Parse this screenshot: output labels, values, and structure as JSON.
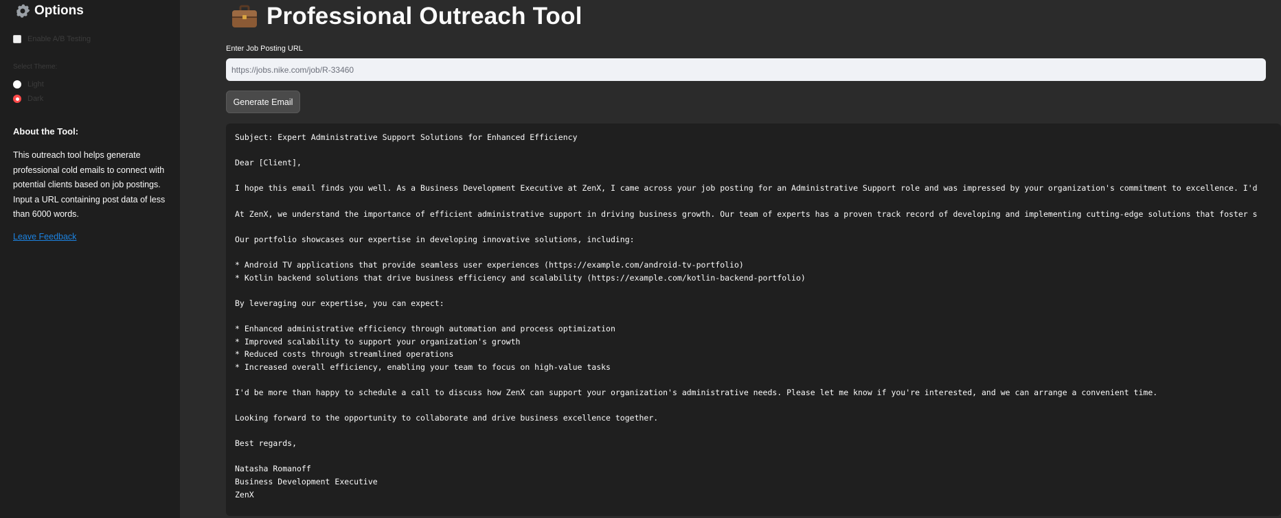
{
  "sidebar": {
    "title": "Options",
    "ab_testing_label": "Enable A/B Testing",
    "theme_label": "Select Theme:",
    "theme_options": [
      "Light",
      "Dark"
    ],
    "theme_selected": "Dark",
    "about_heading": "About the Tool:",
    "about_text": "This outreach tool helps generate professional cold emails to connect with potential clients based on job postings. Input a URL containing post data of less than 6000 words.",
    "feedback_link": "Leave Feedback"
  },
  "main": {
    "title": "Professional Outreach Tool",
    "url_label": "Enter Job Posting URL",
    "url_placeholder": "https://jobs.nike.com/job/R-33460",
    "generate_button": "Generate Email",
    "email_output": "Subject: Expert Administrative Support Solutions for Enhanced Efficiency\n\nDear [Client],\n\nI hope this email finds you well. As a Business Development Executive at ZenX, I came across your job posting for an Administrative Support role and was impressed by your organization's commitment to excellence. I'd\n\nAt ZenX, we understand the importance of efficient administrative support in driving business growth. Our team of experts has a proven track record of developing and implementing cutting-edge solutions that foster s\n\nOur portfolio showcases our expertise in developing innovative solutions, including:\n\n* Android TV applications that provide seamless user experiences (https://example.com/android-tv-portfolio)\n* Kotlin backend solutions that drive business efficiency and scalability (https://example.com/kotlin-backend-portfolio)\n\nBy leveraging our expertise, you can expect:\n\n* Enhanced administrative efficiency through automation and process optimization\n* Improved scalability to support your organization's growth\n* Reduced costs through streamlined operations\n* Increased overall efficiency, enabling your team to focus on high-value tasks\n\nI'd be more than happy to schedule a call to discuss how ZenX can support your organization's administrative needs. Please let me know if you're interested, and we can arrange a convenient time.\n\nLooking forward to the opportunity to collaborate and drive business excellence together.\n\nBest regards,\n\nNatasha Romanoff\nBusiness Development Executive\nZenX"
  },
  "icons": {
    "options": "gear-icon",
    "title": "briefcase-icon"
  },
  "colors": {
    "main_bg": "#2b2b2b",
    "sidebar_bg": "#1e1e1e",
    "code_bg": "#1f1f1f",
    "accent": "#ff4b4b",
    "link": "#1c83e1"
  }
}
